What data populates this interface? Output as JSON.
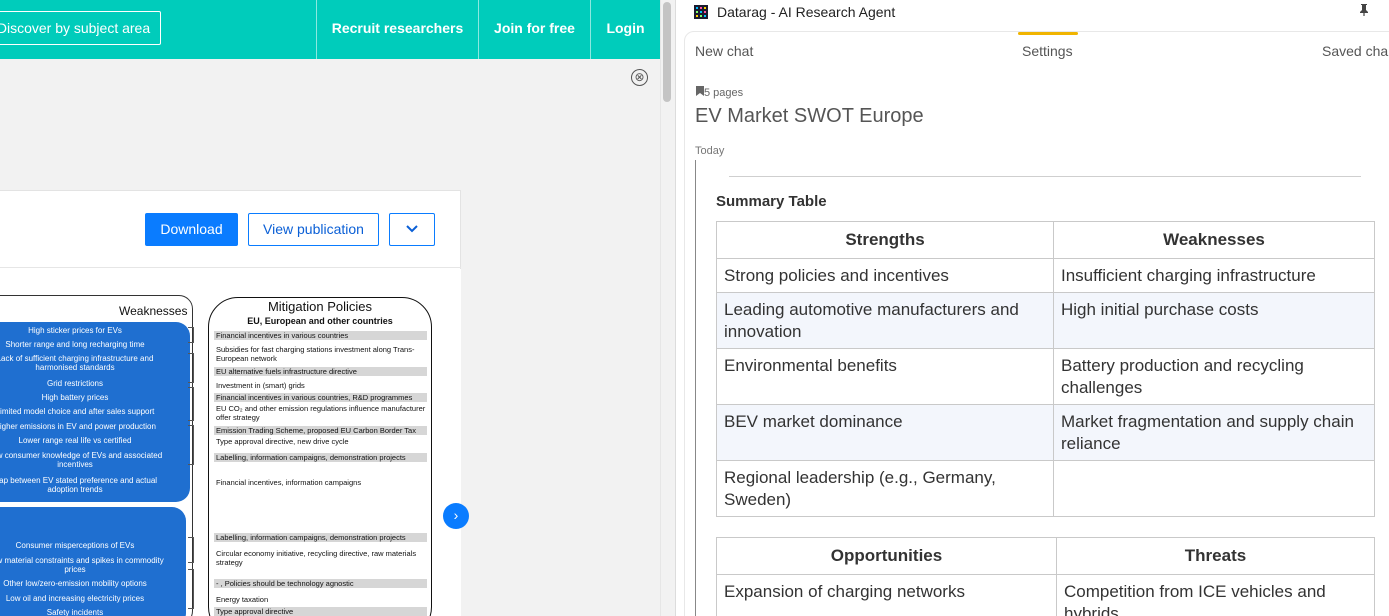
{
  "site": {
    "discover_label": "Discover by subject area",
    "nav": [
      "Recruit researchers",
      "Join for free",
      "Login"
    ],
    "close_glyph": "⊗"
  },
  "publication": {
    "download_label": "Download",
    "view_label": "View publication",
    "more_glyph": "⌄",
    "next_glyph": "›"
  },
  "figure": {
    "weaknesses_title": "Weaknesses",
    "weaknesses_group1": [
      "High sticker prices for EVs",
      "Shorter range and long recharging time",
      "Lack of sufficient charging infrastructure and harmonised standards",
      "Grid restrictions",
      "High battery prices",
      "Limited model choice and after sales support",
      "Higher emissions in EV and power production",
      "Lower range real life vs certified",
      "Low consumer knowledge of EVs and associated incentives",
      "Gap between EV stated preference and actual adoption trends"
    ],
    "weaknesses_group2": [
      "Consumer misperceptions of EVs",
      "Raw material constraints and spikes in commodity prices",
      "Other low/zero-emission mobility options",
      "Low oil and increasing electricity prices",
      "Safety incidents"
    ],
    "mitigation_title": "Mitigation Policies",
    "mitigation_subtitle": "EU, European and other countries",
    "mitigation_items": [
      "Financial incentives in various countries",
      "Subsidies for fast charging stations investment along Trans-European network",
      "EU alternative fuels infrastructure directive",
      "Investment in (smart) grids",
      "Financial incentives in various countries, R&D programmes",
      "EU CO₂ and other emission regulations influence manufacturer offer strategy",
      "Emission Trading Scheme, proposed EU Carbon Border Tax",
      "Type approval directive, new drive cycle",
      "Labelling, information campaigns, demonstration projects",
      "Financial incentives, information campaigns",
      "Labelling, information campaigns, demonstration projects",
      "Circular economy initiative, recycling directive, raw materials strategy",
      "- , Policies should be technology agnostic",
      "Energy taxation",
      "Type approval directive"
    ]
  },
  "agent": {
    "app_title": "Datarag - AI Research Agent",
    "pin_glyph": "📌",
    "tabs": [
      "New chat",
      "Settings",
      "Saved cha"
    ],
    "pages_badge": "5 pages",
    "chat_title": "EV Market SWOT Europe",
    "today_label": "Today",
    "summary_title": "Summary Table",
    "table1": {
      "headers": [
        "Strengths",
        "Weaknesses"
      ],
      "rows": [
        [
          "Strong policies and incentives",
          "Insufficient charging infrastructure"
        ],
        [
          "Leading automotive manufacturers and innovation",
          "High initial purchase costs"
        ],
        [
          "Environmental benefits",
          "Battery production and recycling challenges"
        ],
        [
          "BEV market dominance",
          "Market fragmentation and supply chain reliance"
        ],
        [
          "Regional leadership (e.g., Germany, Sweden)",
          ""
        ]
      ]
    },
    "table2": {
      "headers": [
        "Opportunities",
        "Threats"
      ],
      "rows": [
        [
          "Expansion of charging networks",
          "Competition from ICE vehicles and hybrids"
        ]
      ]
    }
  }
}
